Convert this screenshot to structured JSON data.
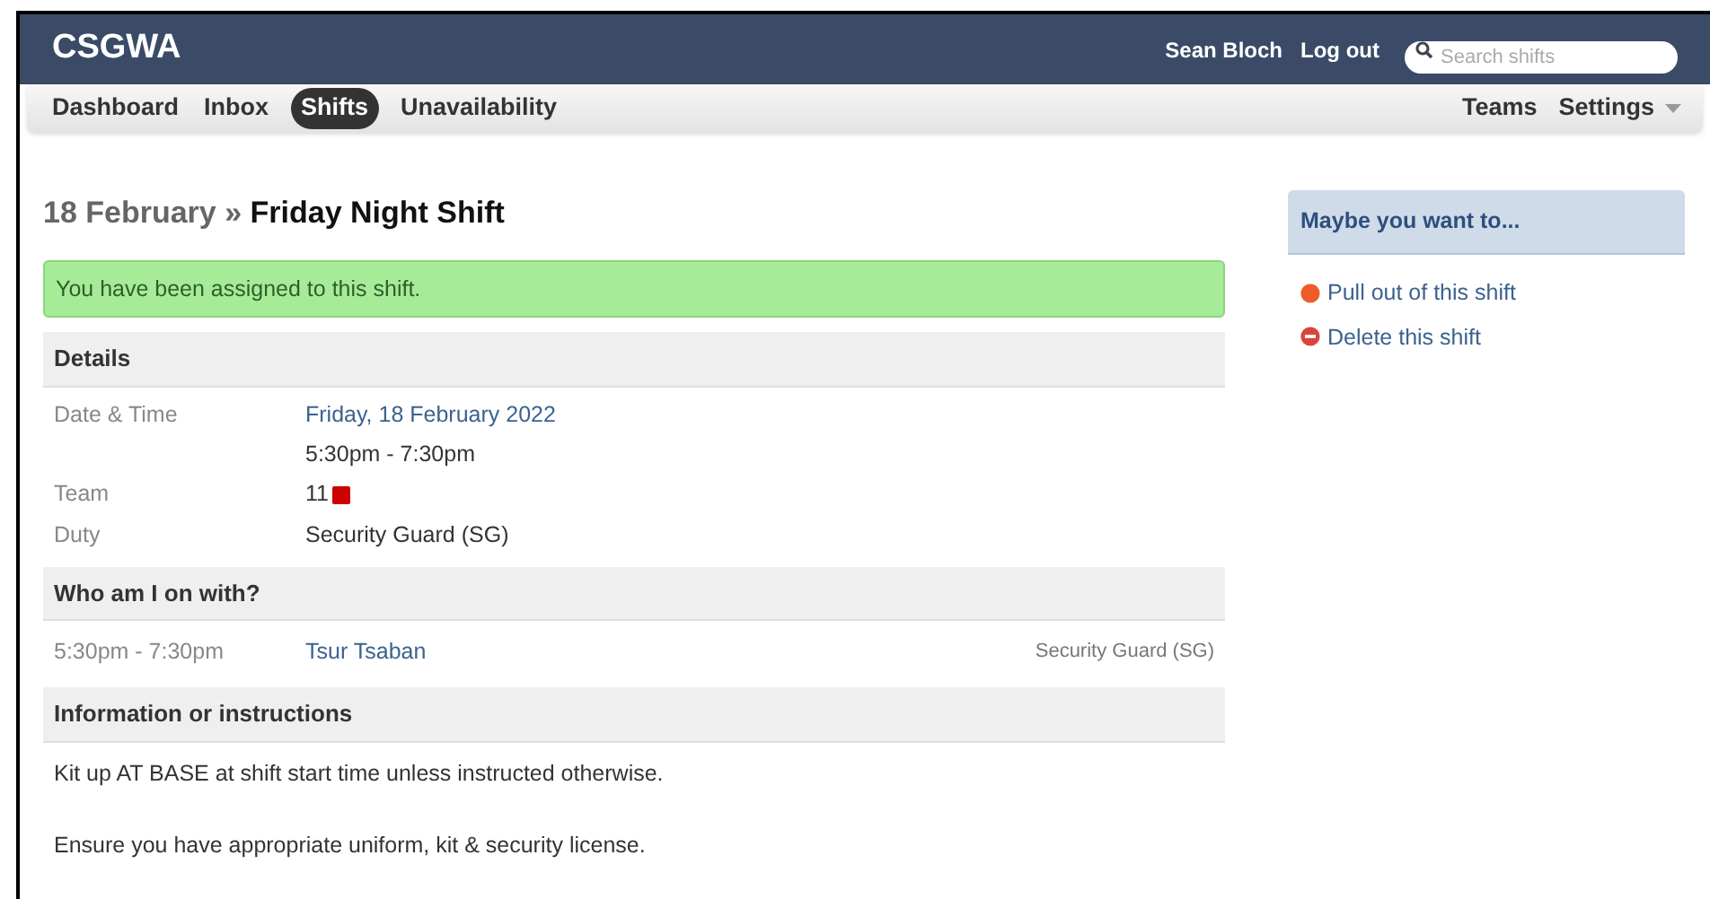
{
  "header": {
    "logo": "CSGWA",
    "user": "Sean Bloch",
    "logout": "Log out",
    "search": {
      "placeholder": "Search shifts"
    }
  },
  "nav": {
    "left": [
      {
        "label": "Dashboard",
        "selected": false
      },
      {
        "label": "Inbox",
        "selected": false
      },
      {
        "label": "Shifts",
        "selected": true
      },
      {
        "label": "Unavailability",
        "selected": false
      }
    ],
    "right": [
      {
        "label": "Teams",
        "dropdown": false
      },
      {
        "label": "Settings",
        "dropdown": true
      }
    ]
  },
  "title": {
    "date": "18 February",
    "separator": "»",
    "name": "Friday Night Shift"
  },
  "alert": "You have been assigned to this shift.",
  "details": {
    "heading": "Details",
    "rows": [
      {
        "label": "Date & Time",
        "values": [
          {
            "text": "Friday, 18 February 2022",
            "kind": "link"
          },
          {
            "text": "5:30pm - 7:30pm",
            "kind": "text"
          }
        ]
      },
      {
        "label": "Team",
        "values": [
          {
            "text": "11",
            "kind": "team",
            "color": "#cc0000"
          }
        ]
      },
      {
        "label": "Duty",
        "values": [
          {
            "text": "Security Guard (SG)",
            "kind": "text"
          }
        ]
      }
    ]
  },
  "colleagues": {
    "heading": "Who am I on with?",
    "rows": [
      {
        "time": "5:30pm - 7:30pm",
        "name": "Tsur Tsaban",
        "duty": "Security Guard (SG)"
      }
    ]
  },
  "info": {
    "heading": "Information or instructions",
    "paragraphs": [
      "Kit up AT BASE at shift start time unless instructed otherwise.",
      "Ensure you have appropriate uniform, kit & security license."
    ]
  },
  "sidebar": {
    "heading": "Maybe you want to...",
    "actions": [
      {
        "label": "Pull out of this shift",
        "kind": "pull"
      },
      {
        "label": "Delete this shift",
        "kind": "delete"
      }
    ]
  }
}
